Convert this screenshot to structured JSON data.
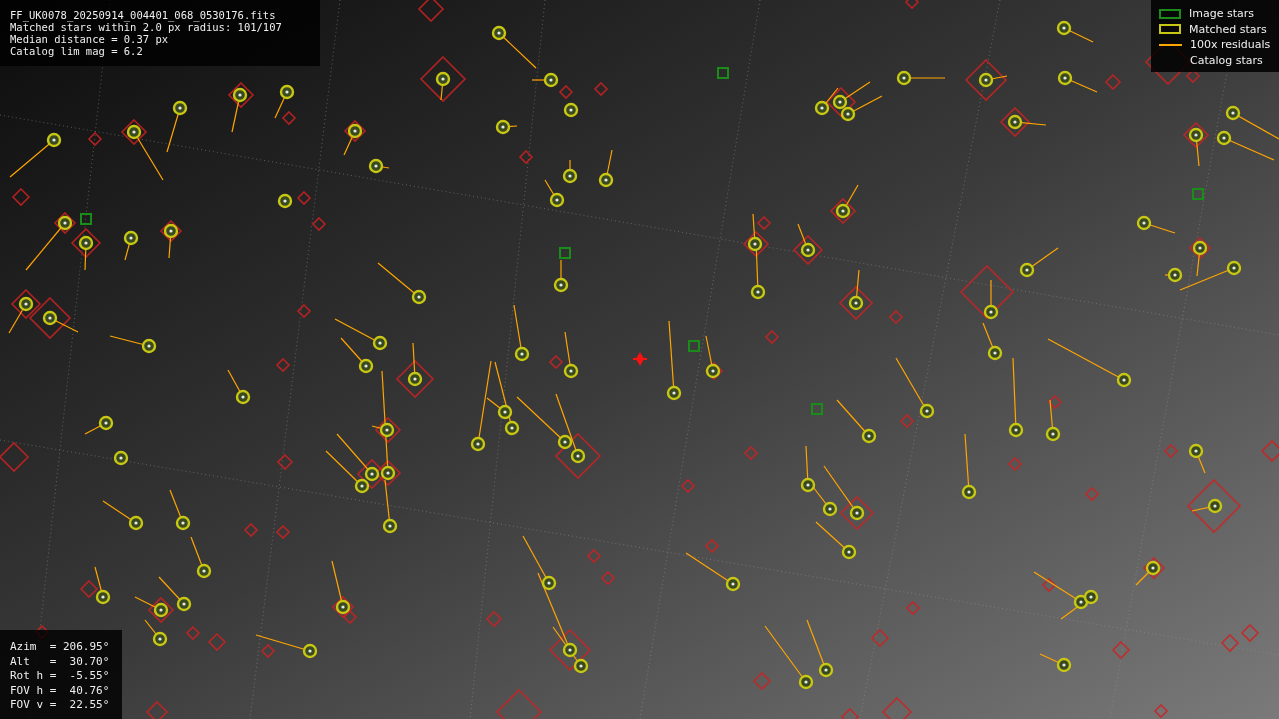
{
  "header": {
    "lines": [
      "FF_UK0078_20250914_004401_068_0530176.fits",
      "Matched stars within 2.0 px radius: 101/107",
      "Median distance = 0.37 px",
      "Catalog lim mag = 6.2"
    ]
  },
  "legend": [
    {
      "label": "Image stars",
      "kind": "box",
      "color": "#1a8c1a"
    },
    {
      "label": "Matched stars",
      "kind": "box",
      "color": "#c8c814"
    },
    {
      "label": "100x residuals",
      "kind": "line",
      "color": "#ffa500"
    },
    {
      "label": "Catalog stars",
      "kind": "none"
    }
  ],
  "pointing": {
    "lines": [
      "Azim  = 206.95°",
      "Alt   =  30.70°",
      "Rot h =  -5.55°",
      "FOV h =  40.76°",
      "FOV v =  22.55°"
    ]
  }
}
